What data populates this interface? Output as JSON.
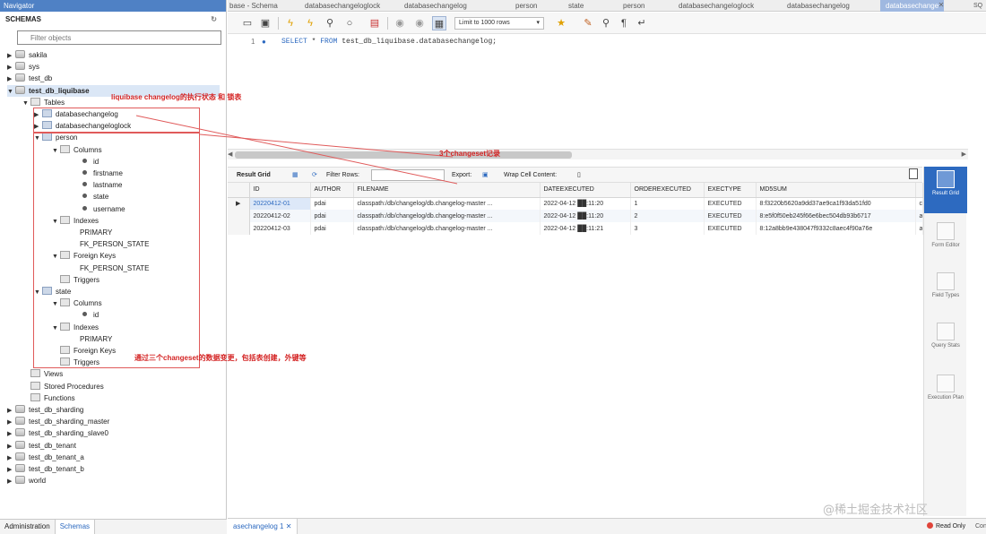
{
  "navigator": {
    "title": "Navigator",
    "schemas_label": "SCHEMAS",
    "refresh_icon": "↻",
    "filter_placeholder": "Filter objects",
    "tree": [
      {
        "label": "sakila",
        "arrow": "▶",
        "icon": "db"
      },
      {
        "label": "sys",
        "arrow": "▶",
        "icon": "db"
      },
      {
        "label": "test_db",
        "arrow": "▶",
        "icon": "db"
      },
      {
        "label": "test_db_liquibase",
        "arrow": "▼",
        "icon": "db"
      },
      {
        "label": "Tables",
        "arrow": "▼",
        "icon": "folder"
      },
      {
        "label": "databasechangelog",
        "arrow": "▶",
        "icon": "tbl"
      },
      {
        "label": "databasechangeloglock",
        "arrow": "▶",
        "icon": "tbl"
      },
      {
        "label": "person",
        "arrow": "▼",
        "icon": "tbl"
      },
      {
        "label": "Columns",
        "arrow": "▼",
        "icon": "folder"
      },
      {
        "label": "id",
        "arrow": "",
        "icon": "col"
      },
      {
        "label": "firstname",
        "arrow": "",
        "icon": "col"
      },
      {
        "label": "lastname",
        "arrow": "",
        "icon": "col"
      },
      {
        "label": "state",
        "arrow": "",
        "icon": "col"
      },
      {
        "label": "username",
        "arrow": "",
        "icon": "col"
      },
      {
        "label": "Indexes",
        "arrow": "▼",
        "icon": "folder"
      },
      {
        "label": "PRIMARY",
        "arrow": "",
        "icon": ""
      },
      {
        "label": "FK_PERSON_STATE",
        "arrow": "",
        "icon": ""
      },
      {
        "label": "Foreign Keys",
        "arrow": "▼",
        "icon": "folder"
      },
      {
        "label": "FK_PERSON_STATE",
        "arrow": "",
        "icon": ""
      },
      {
        "label": "Triggers",
        "arrow": "",
        "icon": "folder"
      },
      {
        "label": "state",
        "arrow": "▼",
        "icon": "tbl"
      },
      {
        "label": "Columns",
        "arrow": "▼",
        "icon": "folder"
      },
      {
        "label": "id",
        "arrow": "",
        "icon": "col"
      },
      {
        "label": "Indexes",
        "arrow": "▼",
        "icon": "folder"
      },
      {
        "label": "PRIMARY",
        "arrow": "",
        "icon": ""
      },
      {
        "label": "Foreign Keys",
        "arrow": "",
        "icon": "folder"
      },
      {
        "label": "Triggers",
        "arrow": "",
        "icon": "folder"
      },
      {
        "label": "Views",
        "arrow": "",
        "icon": "folder"
      },
      {
        "label": "Stored Procedures",
        "arrow": "",
        "icon": "folder"
      },
      {
        "label": "Functions",
        "arrow": "",
        "icon": "folder"
      },
      {
        "label": "test_db_sharding",
        "arrow": "▶",
        "icon": "db"
      },
      {
        "label": "test_db_sharding_master",
        "arrow": "▶",
        "icon": "db"
      },
      {
        "label": "test_db_sharding_slave0",
        "arrow": "▶",
        "icon": "db"
      },
      {
        "label": "test_db_tenant",
        "arrow": "▶",
        "icon": "db"
      },
      {
        "label": "test_db_tenant_a",
        "arrow": "▶",
        "icon": "db"
      },
      {
        "label": "test_db_tenant_b",
        "arrow": "▶",
        "icon": "db"
      },
      {
        "label": "world",
        "arrow": "▶",
        "icon": "db"
      }
    ],
    "bottom_tabs": [
      "Administration",
      "Schemas"
    ]
  },
  "tabs": {
    "items": [
      "base - Schema",
      "databasechangeloglock",
      "databasechangelog",
      "person",
      "state",
      "person",
      "databasechangeloglock",
      "databasechangelog"
    ],
    "active": "databasechange",
    "close": "✕",
    "sq": "SQ"
  },
  "toolbar": {
    "limit_label": "Limit to 1000 rows",
    "chevron": "▾"
  },
  "editor": {
    "line_number": "1",
    "marker": "●",
    "sql_keyword_1": "SELECT",
    "sql_star": " * ",
    "sql_keyword_2": "FROM",
    "sql_rest": " test_db_liquibase.databasechangelog;"
  },
  "result_toolbar": {
    "result_grid": "Result Grid",
    "filter_rows": "Filter Rows:",
    "export": "Export:",
    "wrap": "Wrap Cell Content:"
  },
  "grid": {
    "columns": [
      "ID",
      "AUTHOR",
      "FILENAME",
      "DATEEXECUTED",
      "ORDEREXECUTED",
      "EXECTYPE",
      "MD5SUM",
      ""
    ],
    "rows": [
      [
        "20220412-01",
        "pdai",
        "classpath:/db/changelog/db.changelog-master ...",
        "2022-04-12 ██:11:20",
        "1",
        "EXECUTED",
        "8:f3220b5620a9dd37ae9ca1f93da51fd0",
        "cr"
      ],
      [
        "20220412-02",
        "pdai",
        "classpath:/db/changelog/db.changelog-master ...",
        "2022-04-12 ██:11:20",
        "2",
        "EXECUTED",
        "8:e5f0f50eb245f66e6bec504db93b6717",
        "ad"
      ],
      [
        "20220412-03",
        "pdai",
        "classpath:/db/changelog/db.changelog-master ...",
        "2022-04-12 ██:11:21",
        "3",
        "EXECUTED",
        "8:12a8bb9e438047f9332c8aec4f90a76e",
        "ad"
      ]
    ]
  },
  "right_panel": [
    "Result Grid",
    "Form Editor",
    "Field Types",
    "Query Stats",
    "Execution Plan"
  ],
  "bottom": {
    "tab": "asechangelog 1",
    "tab_close": "✕",
    "read_only": "Read Only",
    "context": "Con"
  },
  "annotations": {
    "a1": "liquibase changelog的执行状态 和 锁表",
    "a2": "3个changeset记录",
    "a3": "通过三个changeset的数据变更，包括表创建，外键等"
  },
  "watermark": "@稀土掘金技术社区",
  "colors": {
    "accent": "#2d6ac0",
    "annotation": "#d42424",
    "nav_title": "#4f81c5"
  }
}
